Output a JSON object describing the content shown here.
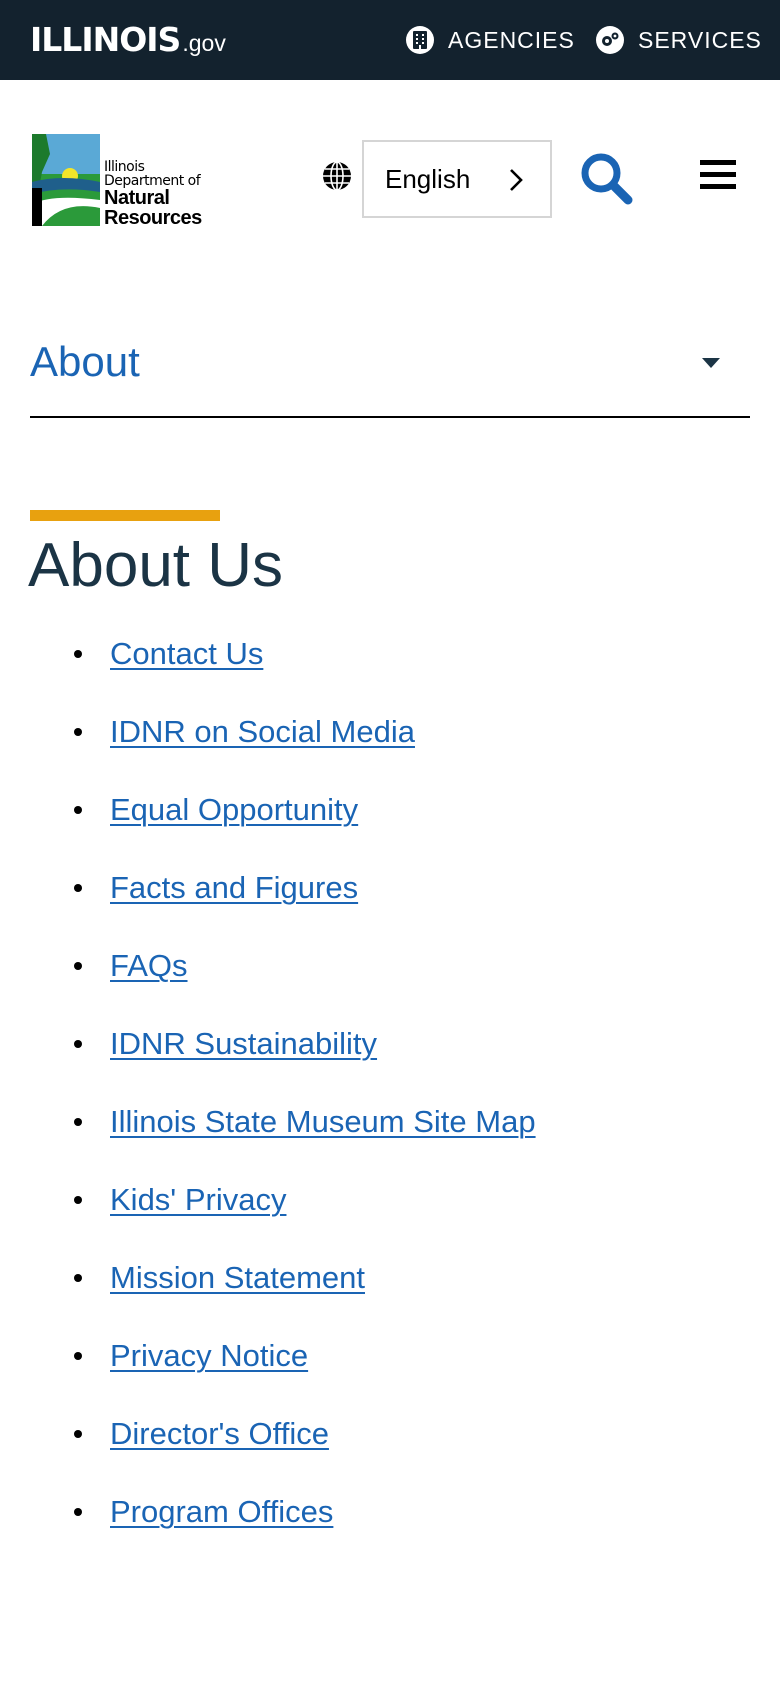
{
  "topbar": {
    "logo_main": "ILLINOIS",
    "logo_suffix": ".gov",
    "agencies_label": "AGENCIES",
    "services_label": "SERVICES",
    "bg_color": "#13222e"
  },
  "header": {
    "logo_line1": "Illinois",
    "logo_line2": "Department of",
    "logo_line3": "Natural",
    "logo_line4": "Resources",
    "language_value": "English",
    "globe_icon": "globe-icon",
    "search_icon": "search-icon",
    "menu_icon": "hamburger-menu-icon",
    "accent_color": "#1a64b4"
  },
  "section_nav": {
    "label": "About",
    "caret_icon": "caret-down-icon"
  },
  "main": {
    "title": "About Us",
    "accent_bar_color": "#e8a10f",
    "links": [
      "Contact Us",
      "IDNR on Social Media",
      "Equal Opportunity",
      "Facts and Figures",
      "FAQs",
      "IDNR Sustainability",
      "Illinois State Museum Site Map",
      "Kids' Privacy",
      "Mission Statement",
      "Privacy Notice",
      "Director's Office",
      "Program Offices"
    ]
  }
}
